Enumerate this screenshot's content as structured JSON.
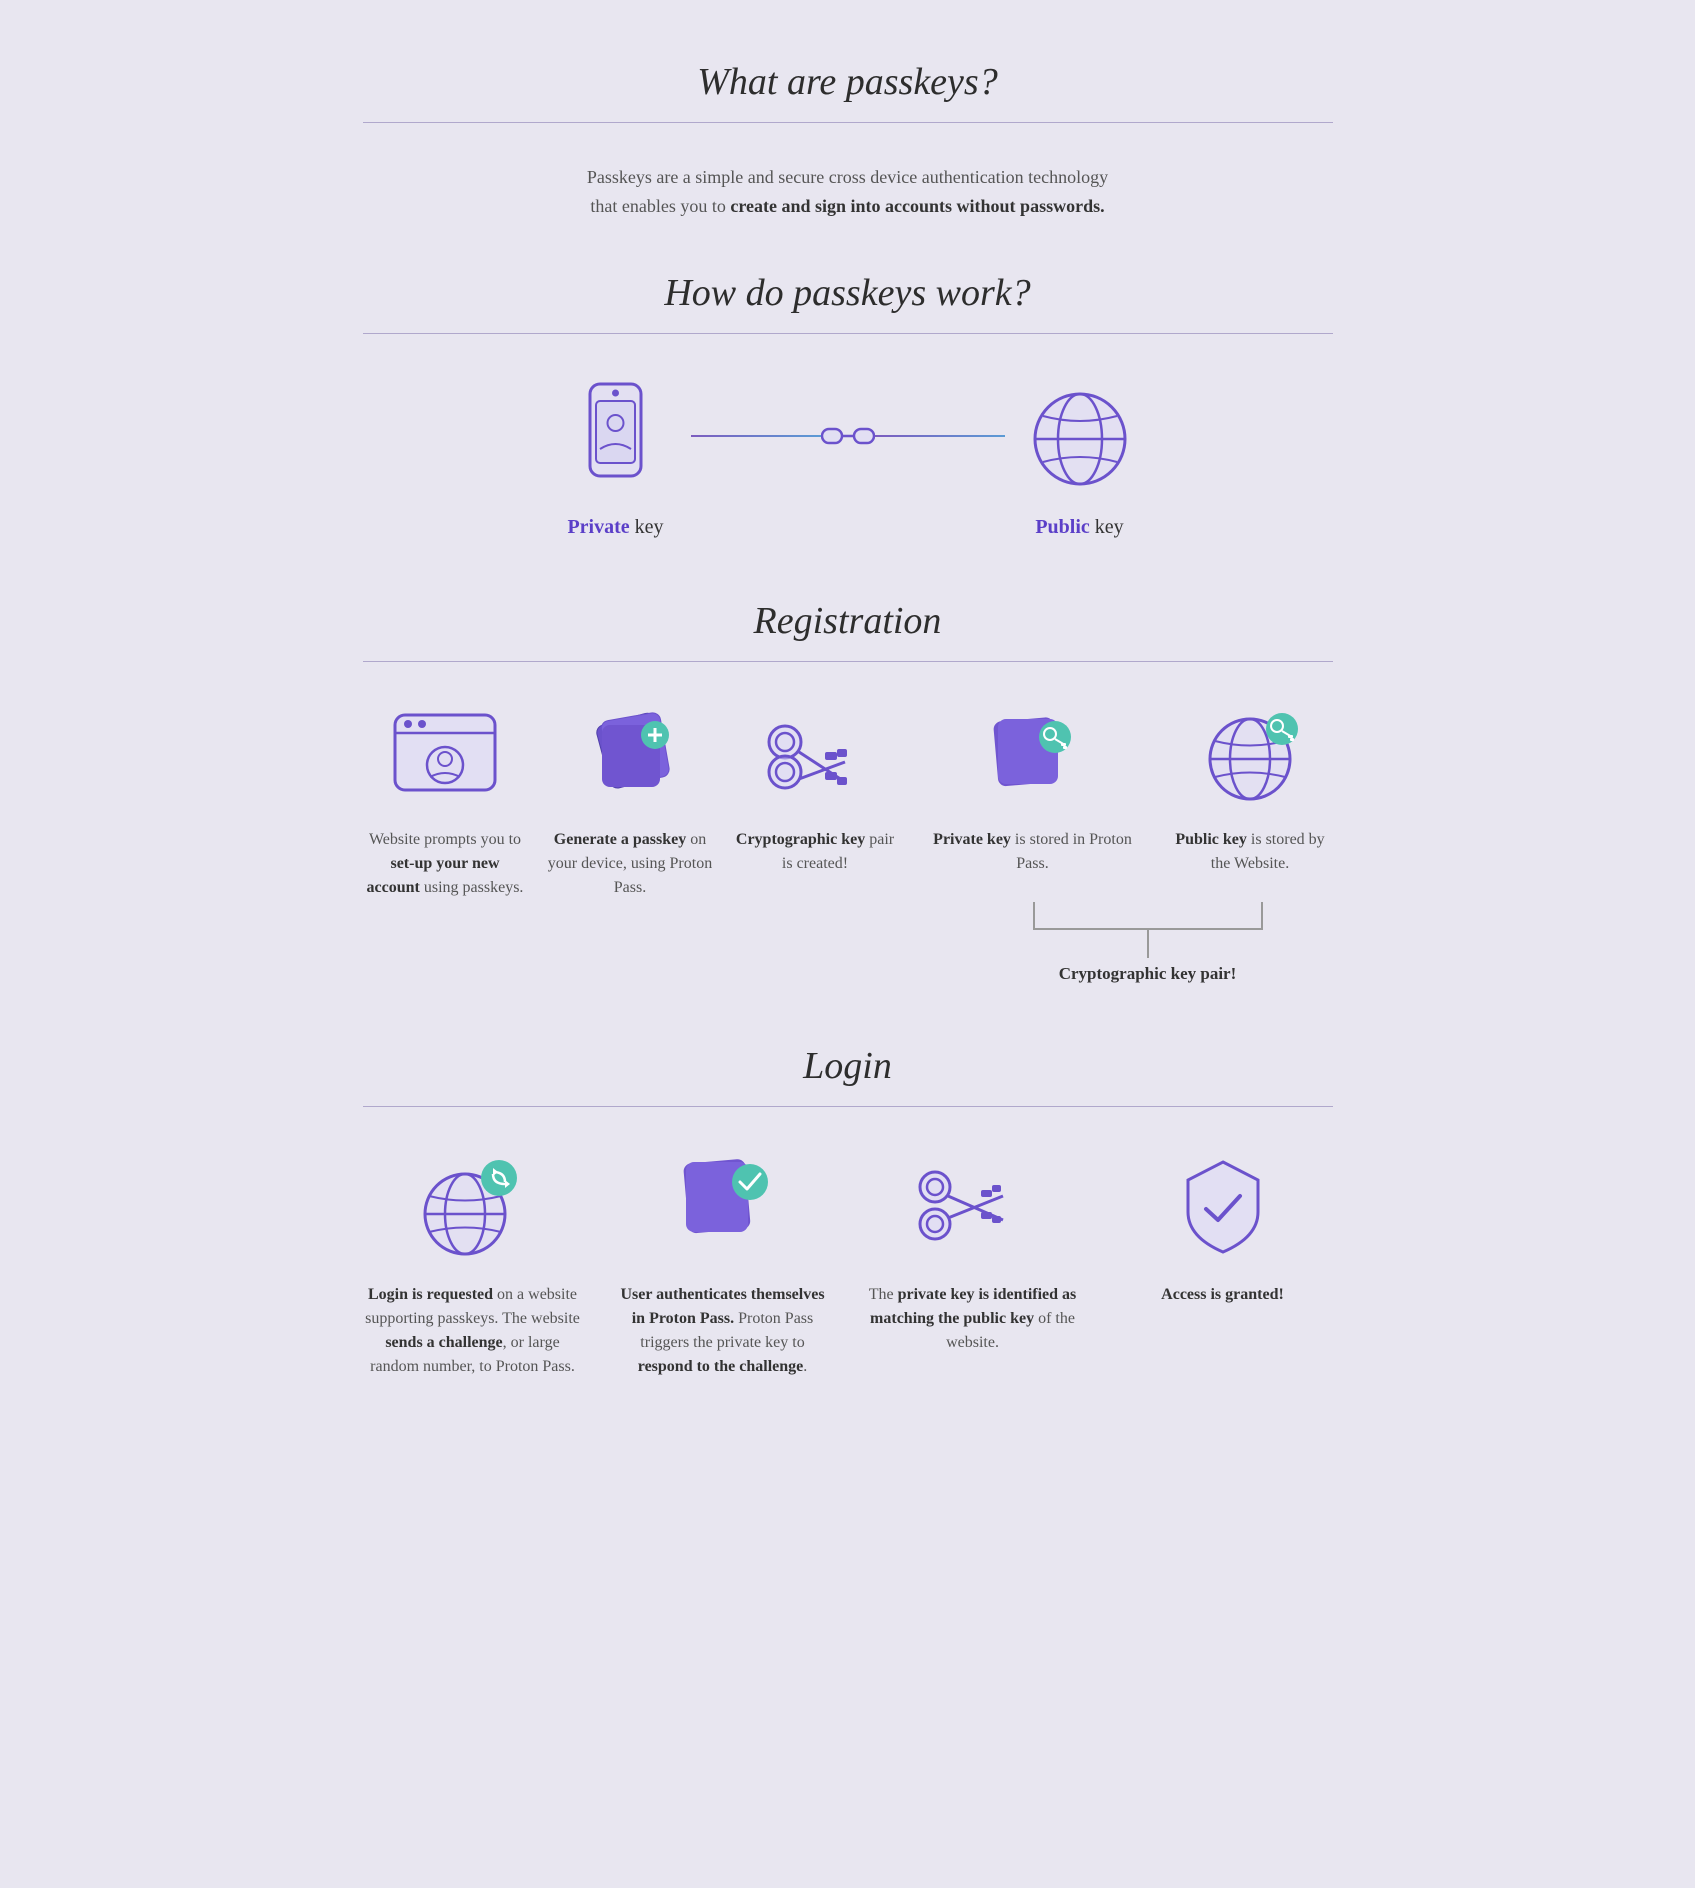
{
  "page": {
    "title": "What are passkeys?",
    "intro": {
      "line1": "Passkeys are a simple and secure cross device authentication technology",
      "line2_pre": "that enables you to ",
      "line2_bold": "create and sign into accounts without passwords.",
      "line2_post": ""
    },
    "how_title": "How do passkeys work?",
    "key_pair": {
      "private_label_bold": "Private",
      "private_label": " key",
      "public_label_bold": "Public",
      "public_label": " key"
    },
    "registration": {
      "title": "Registration",
      "steps": [
        {
          "text_pre": "Website prompts you to ",
          "text_bold": "set-up your new account",
          "text_post": " using passkeys."
        },
        {
          "text_bold_pre": "Generate a passkey",
          "text_post": " on your device, using Proton Pass."
        },
        {
          "text_bold": "Cryptographic key",
          "text_post": " pair is created!"
        },
        {
          "text_bold": "Private key",
          "text_post": " is stored in Proton Pass."
        },
        {
          "text_bold": "Public key",
          "text_post": " is stored by the Website."
        }
      ],
      "bracket_label": "Cryptographic key pair!"
    },
    "login": {
      "title": "Login",
      "steps": [
        {
          "text_bold": "Login is requested",
          "text_pre": "",
          "text_mid": " on a website supporting passkeys. The website ",
          "text_bold2": "sends a challenge",
          "text_post": ", or large random number, to Proton Pass."
        },
        {
          "text_bold": "User authenticates themselves in Proton Pass.",
          "text_post": " Proton Pass triggers the private key to ",
          "text_bold2": "respond to the challenge",
          "text_end": "."
        },
        {
          "text_pre": "The ",
          "text_bold": "private key is identified as matching the public key",
          "text_post": " of the website."
        },
        {
          "text_bold": "Access is granted!"
        }
      ]
    }
  }
}
